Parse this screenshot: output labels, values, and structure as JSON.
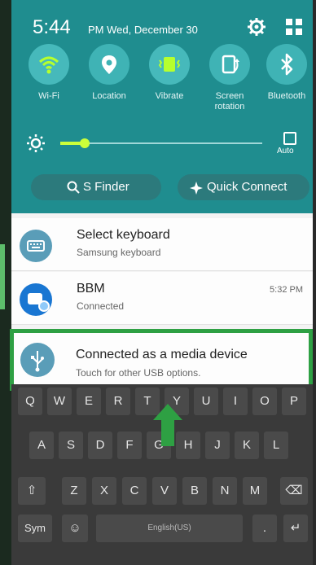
{
  "status_bar": {
    "time": "5:44",
    "date": "PM Wed, December 30"
  },
  "quick_settings": [
    {
      "label": "Wi-Fi",
      "icon": "wifi-icon"
    },
    {
      "label": "Location",
      "icon": "location-icon"
    },
    {
      "label": "Vibrate",
      "icon": "vibrate-icon"
    },
    {
      "label": "Screen\nrotation",
      "icon": "screen-rotation-icon"
    },
    {
      "label": "Bluetooth",
      "icon": "bluetooth-icon"
    }
  ],
  "brightness": {
    "auto_label": "Auto",
    "level": 0.12
  },
  "actions": {
    "s_finder": "S Finder",
    "quick_connect": "Quick Connect"
  },
  "notifications": [
    {
      "title": "Select keyboard",
      "subtitle": "Samsung keyboard",
      "time": ""
    },
    {
      "title": "BBM",
      "subtitle": "Connected",
      "time": "5:32 PM"
    },
    {
      "title": "Connected as a media device",
      "subtitle": "Touch for other USB options.",
      "time": ""
    }
  ],
  "keyboard": {
    "row1": [
      "Q",
      "W",
      "E",
      "R",
      "T",
      "Y",
      "U",
      "I",
      "O",
      "P"
    ],
    "row2": [
      "A",
      "S",
      "D",
      "F",
      "G",
      "H",
      "J",
      "K",
      "L"
    ],
    "row3": [
      "Z",
      "X",
      "C",
      "V",
      "B",
      "N",
      "M"
    ],
    "sym": "Sym",
    "space_lang": "English(US)"
  },
  "colors": {
    "shade": "#1f8d8f",
    "accent": "#2ea043",
    "bbm": "#1976d2"
  }
}
